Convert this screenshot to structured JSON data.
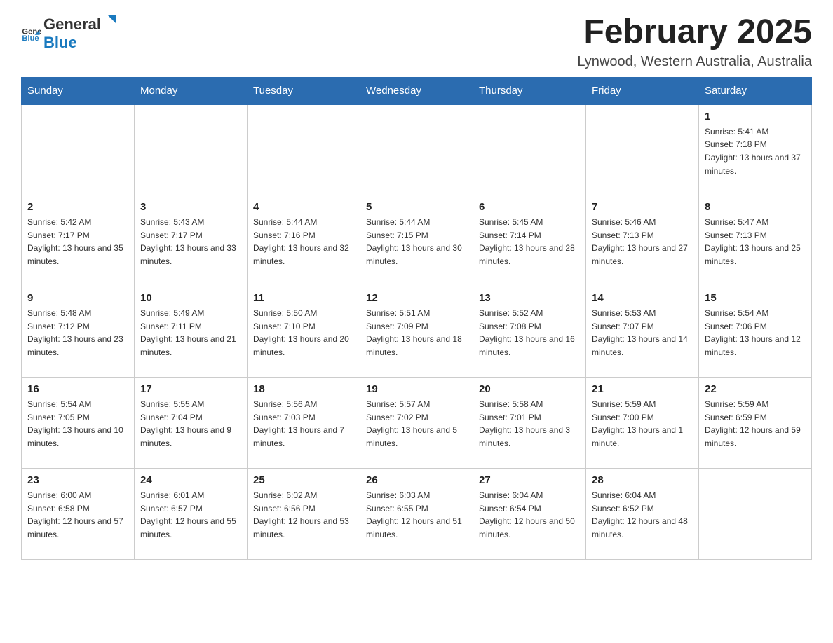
{
  "logo": {
    "general": "General",
    "blue": "Blue"
  },
  "title": "February 2025",
  "location": "Lynwood, Western Australia, Australia",
  "days_of_week": [
    "Sunday",
    "Monday",
    "Tuesday",
    "Wednesday",
    "Thursday",
    "Friday",
    "Saturday"
  ],
  "weeks": [
    [
      {
        "day": "",
        "info": ""
      },
      {
        "day": "",
        "info": ""
      },
      {
        "day": "",
        "info": ""
      },
      {
        "day": "",
        "info": ""
      },
      {
        "day": "",
        "info": ""
      },
      {
        "day": "",
        "info": ""
      },
      {
        "day": "1",
        "info": "Sunrise: 5:41 AM\nSunset: 7:18 PM\nDaylight: 13 hours and 37 minutes."
      }
    ],
    [
      {
        "day": "2",
        "info": "Sunrise: 5:42 AM\nSunset: 7:17 PM\nDaylight: 13 hours and 35 minutes."
      },
      {
        "day": "3",
        "info": "Sunrise: 5:43 AM\nSunset: 7:17 PM\nDaylight: 13 hours and 33 minutes."
      },
      {
        "day": "4",
        "info": "Sunrise: 5:44 AM\nSunset: 7:16 PM\nDaylight: 13 hours and 32 minutes."
      },
      {
        "day": "5",
        "info": "Sunrise: 5:44 AM\nSunset: 7:15 PM\nDaylight: 13 hours and 30 minutes."
      },
      {
        "day": "6",
        "info": "Sunrise: 5:45 AM\nSunset: 7:14 PM\nDaylight: 13 hours and 28 minutes."
      },
      {
        "day": "7",
        "info": "Sunrise: 5:46 AM\nSunset: 7:13 PM\nDaylight: 13 hours and 27 minutes."
      },
      {
        "day": "8",
        "info": "Sunrise: 5:47 AM\nSunset: 7:13 PM\nDaylight: 13 hours and 25 minutes."
      }
    ],
    [
      {
        "day": "9",
        "info": "Sunrise: 5:48 AM\nSunset: 7:12 PM\nDaylight: 13 hours and 23 minutes."
      },
      {
        "day": "10",
        "info": "Sunrise: 5:49 AM\nSunset: 7:11 PM\nDaylight: 13 hours and 21 minutes."
      },
      {
        "day": "11",
        "info": "Sunrise: 5:50 AM\nSunset: 7:10 PM\nDaylight: 13 hours and 20 minutes."
      },
      {
        "day": "12",
        "info": "Sunrise: 5:51 AM\nSunset: 7:09 PM\nDaylight: 13 hours and 18 minutes."
      },
      {
        "day": "13",
        "info": "Sunrise: 5:52 AM\nSunset: 7:08 PM\nDaylight: 13 hours and 16 minutes."
      },
      {
        "day": "14",
        "info": "Sunrise: 5:53 AM\nSunset: 7:07 PM\nDaylight: 13 hours and 14 minutes."
      },
      {
        "day": "15",
        "info": "Sunrise: 5:54 AM\nSunset: 7:06 PM\nDaylight: 13 hours and 12 minutes."
      }
    ],
    [
      {
        "day": "16",
        "info": "Sunrise: 5:54 AM\nSunset: 7:05 PM\nDaylight: 13 hours and 10 minutes."
      },
      {
        "day": "17",
        "info": "Sunrise: 5:55 AM\nSunset: 7:04 PM\nDaylight: 13 hours and 9 minutes."
      },
      {
        "day": "18",
        "info": "Sunrise: 5:56 AM\nSunset: 7:03 PM\nDaylight: 13 hours and 7 minutes."
      },
      {
        "day": "19",
        "info": "Sunrise: 5:57 AM\nSunset: 7:02 PM\nDaylight: 13 hours and 5 minutes."
      },
      {
        "day": "20",
        "info": "Sunrise: 5:58 AM\nSunset: 7:01 PM\nDaylight: 13 hours and 3 minutes."
      },
      {
        "day": "21",
        "info": "Sunrise: 5:59 AM\nSunset: 7:00 PM\nDaylight: 13 hours and 1 minute."
      },
      {
        "day": "22",
        "info": "Sunrise: 5:59 AM\nSunset: 6:59 PM\nDaylight: 12 hours and 59 minutes."
      }
    ],
    [
      {
        "day": "23",
        "info": "Sunrise: 6:00 AM\nSunset: 6:58 PM\nDaylight: 12 hours and 57 minutes."
      },
      {
        "day": "24",
        "info": "Sunrise: 6:01 AM\nSunset: 6:57 PM\nDaylight: 12 hours and 55 minutes."
      },
      {
        "day": "25",
        "info": "Sunrise: 6:02 AM\nSunset: 6:56 PM\nDaylight: 12 hours and 53 minutes."
      },
      {
        "day": "26",
        "info": "Sunrise: 6:03 AM\nSunset: 6:55 PM\nDaylight: 12 hours and 51 minutes."
      },
      {
        "day": "27",
        "info": "Sunrise: 6:04 AM\nSunset: 6:54 PM\nDaylight: 12 hours and 50 minutes."
      },
      {
        "day": "28",
        "info": "Sunrise: 6:04 AM\nSunset: 6:52 PM\nDaylight: 12 hours and 48 minutes."
      },
      {
        "day": "",
        "info": ""
      }
    ]
  ]
}
